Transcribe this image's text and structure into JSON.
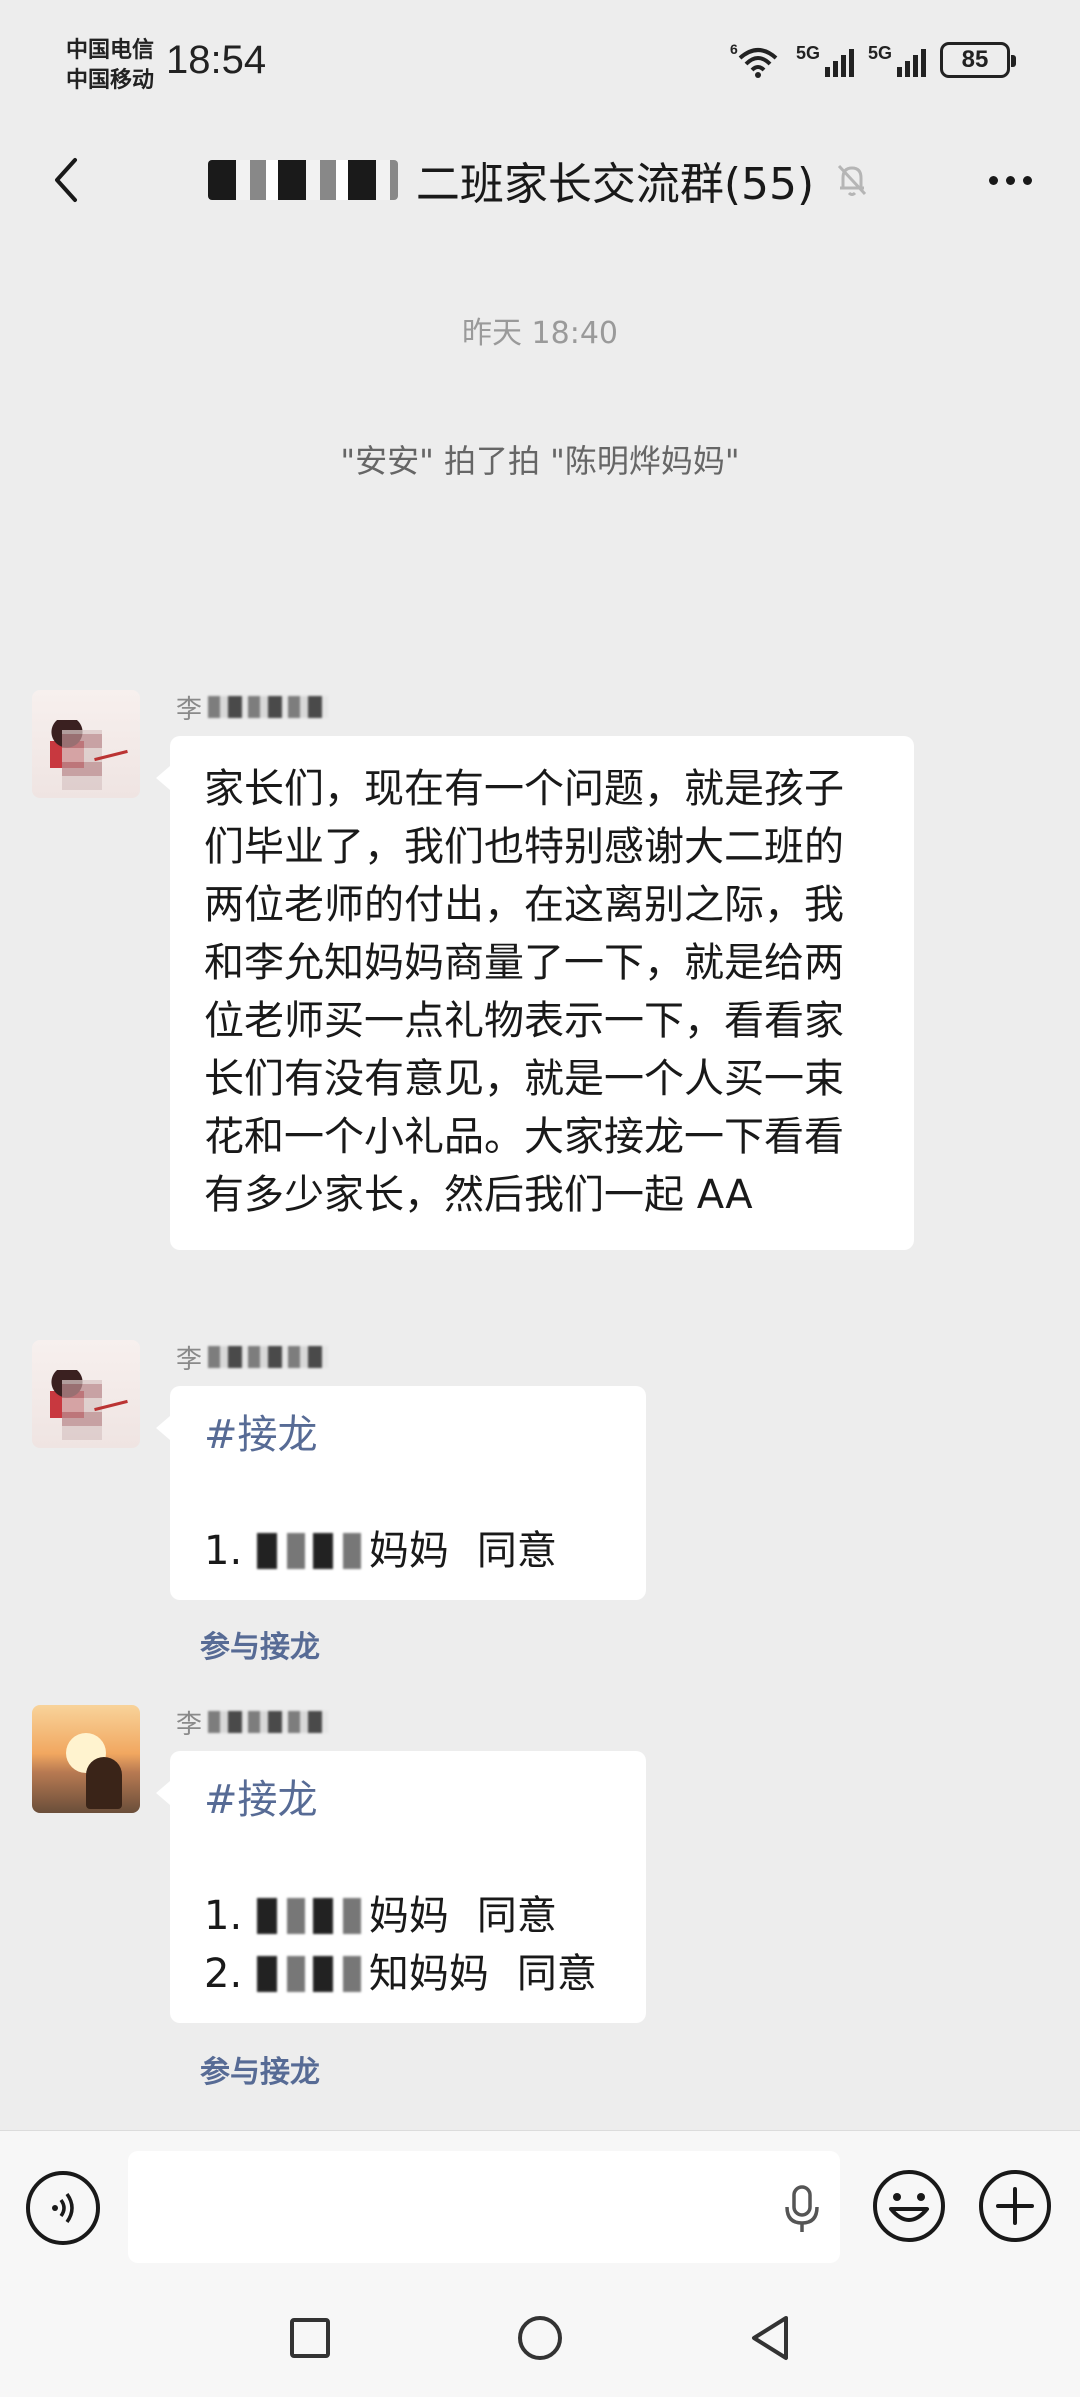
{
  "status_bar": {
    "carrier_1": "中国电信",
    "carrier_2": "中国移动",
    "time": "18:54",
    "network_1": "5G",
    "network_2": "5G",
    "wifi_label": "6",
    "battery": "85"
  },
  "header": {
    "title": "二班家长交流群(55)"
  },
  "system_messages": {
    "timestamp": "昨天 18:40",
    "pat": "\"安安\" 拍了拍 \"陈明烨妈妈\""
  },
  "messages": [
    {
      "sender": "李",
      "text": "家长们，现在有一个问题，就是孩子们毕业了，我们也特别感谢大二班的两位老师的付出，在这离别之际，我和李允知妈妈商量了一下，就是给两位老师买一点礼物表示一下，看看家长们有没有意见，就是一个人买一束花和一个小礼品。大家接龙一下看看有多少家长，然后我们一起 AA"
    },
    {
      "sender": "李",
      "hashtag": "#接龙",
      "entries": [
        {
          "prefix": "1.",
          "name": "妈妈",
          "status": "同意"
        }
      ],
      "join_label": "参与接龙"
    },
    {
      "sender": "李",
      "hashtag": "#接龙",
      "entries": [
        {
          "prefix": "1.",
          "name": "妈妈",
          "status": "同意"
        },
        {
          "prefix": "2.",
          "name": "知妈妈",
          "status": "同意"
        }
      ],
      "join_label": "参与接龙"
    }
  ],
  "icons": {
    "back": "chevron-left-icon",
    "mute": "bell-muted-icon",
    "more": "more-dots-icon",
    "voice": "voice-icon",
    "mic": "microphone-icon",
    "emoji": "emoji-icon",
    "plus": "plus-icon",
    "nav_recent": "square-icon",
    "nav_home": "circle-icon",
    "nav_back": "triangle-back-icon"
  },
  "colors": {
    "background": "#ededed",
    "bubble": "#ffffff",
    "link": "#576b95"
  }
}
